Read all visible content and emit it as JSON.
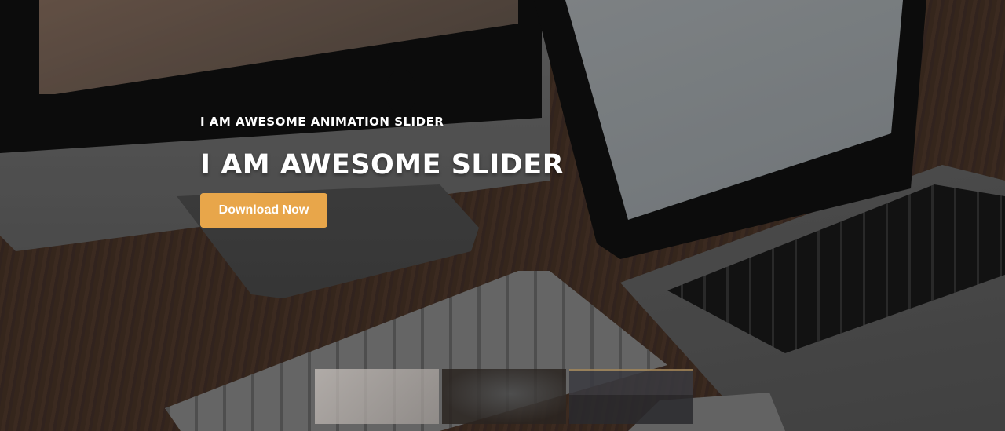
{
  "slider": {
    "subtitle": "I AM AWESOME ANIMATION SLIDER",
    "title": "I AM AWESOME SLIDER",
    "button_label": "Download Now",
    "accent_color": "#e8a64a",
    "active_slide": 1,
    "thumbnail_count": 3
  }
}
